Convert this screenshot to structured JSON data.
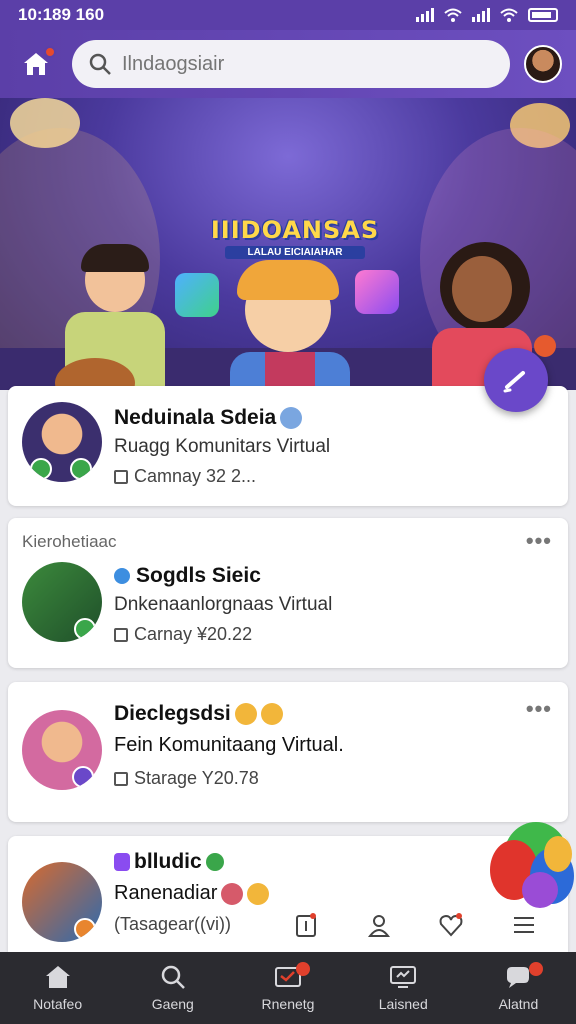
{
  "status_bar": {
    "time": "10:189 160"
  },
  "search": {
    "placeholder": "Ilndaogsiair"
  },
  "hero": {
    "title": "IIIDOANSAS",
    "subtitle": "LALAU  EICIAIAHAR"
  },
  "cards": [
    {
      "title": "Neduinala Sdeia",
      "subtitle": "Ruagg Komunitars Virtual",
      "meta": "Camnay 32 2..."
    },
    {
      "section": "Kierohetiaac",
      "title": "Sogdls Sieic",
      "subtitle": "Dnkenaanlorgnaas Virtual",
      "meta": "Carnay ¥20.22"
    },
    {
      "title": "Dieclegsdsi",
      "subtitle": "Fein Komunitaang Virtual.",
      "meta": "Starage Y20.78"
    },
    {
      "title": "blludic",
      "subtitle": "Ranenadiar",
      "meta": "(Tasagear((vi))"
    }
  ],
  "bottom_nav": [
    {
      "label": "Notafeo",
      "icon": "home-icon"
    },
    {
      "label": "Gaeng",
      "icon": "search-icon"
    },
    {
      "label": "Rnenetg",
      "icon": "message-icon"
    },
    {
      "label": "Laisned",
      "icon": "screen-icon"
    },
    {
      "label": "Alatnd",
      "icon": "chat-icon"
    }
  ],
  "colors": {
    "accent": "#6a48c9",
    "header": "#5b3fa8",
    "nav_bg": "#2b2b30",
    "badge": "#e0402c",
    "check": "#3aa64a"
  }
}
